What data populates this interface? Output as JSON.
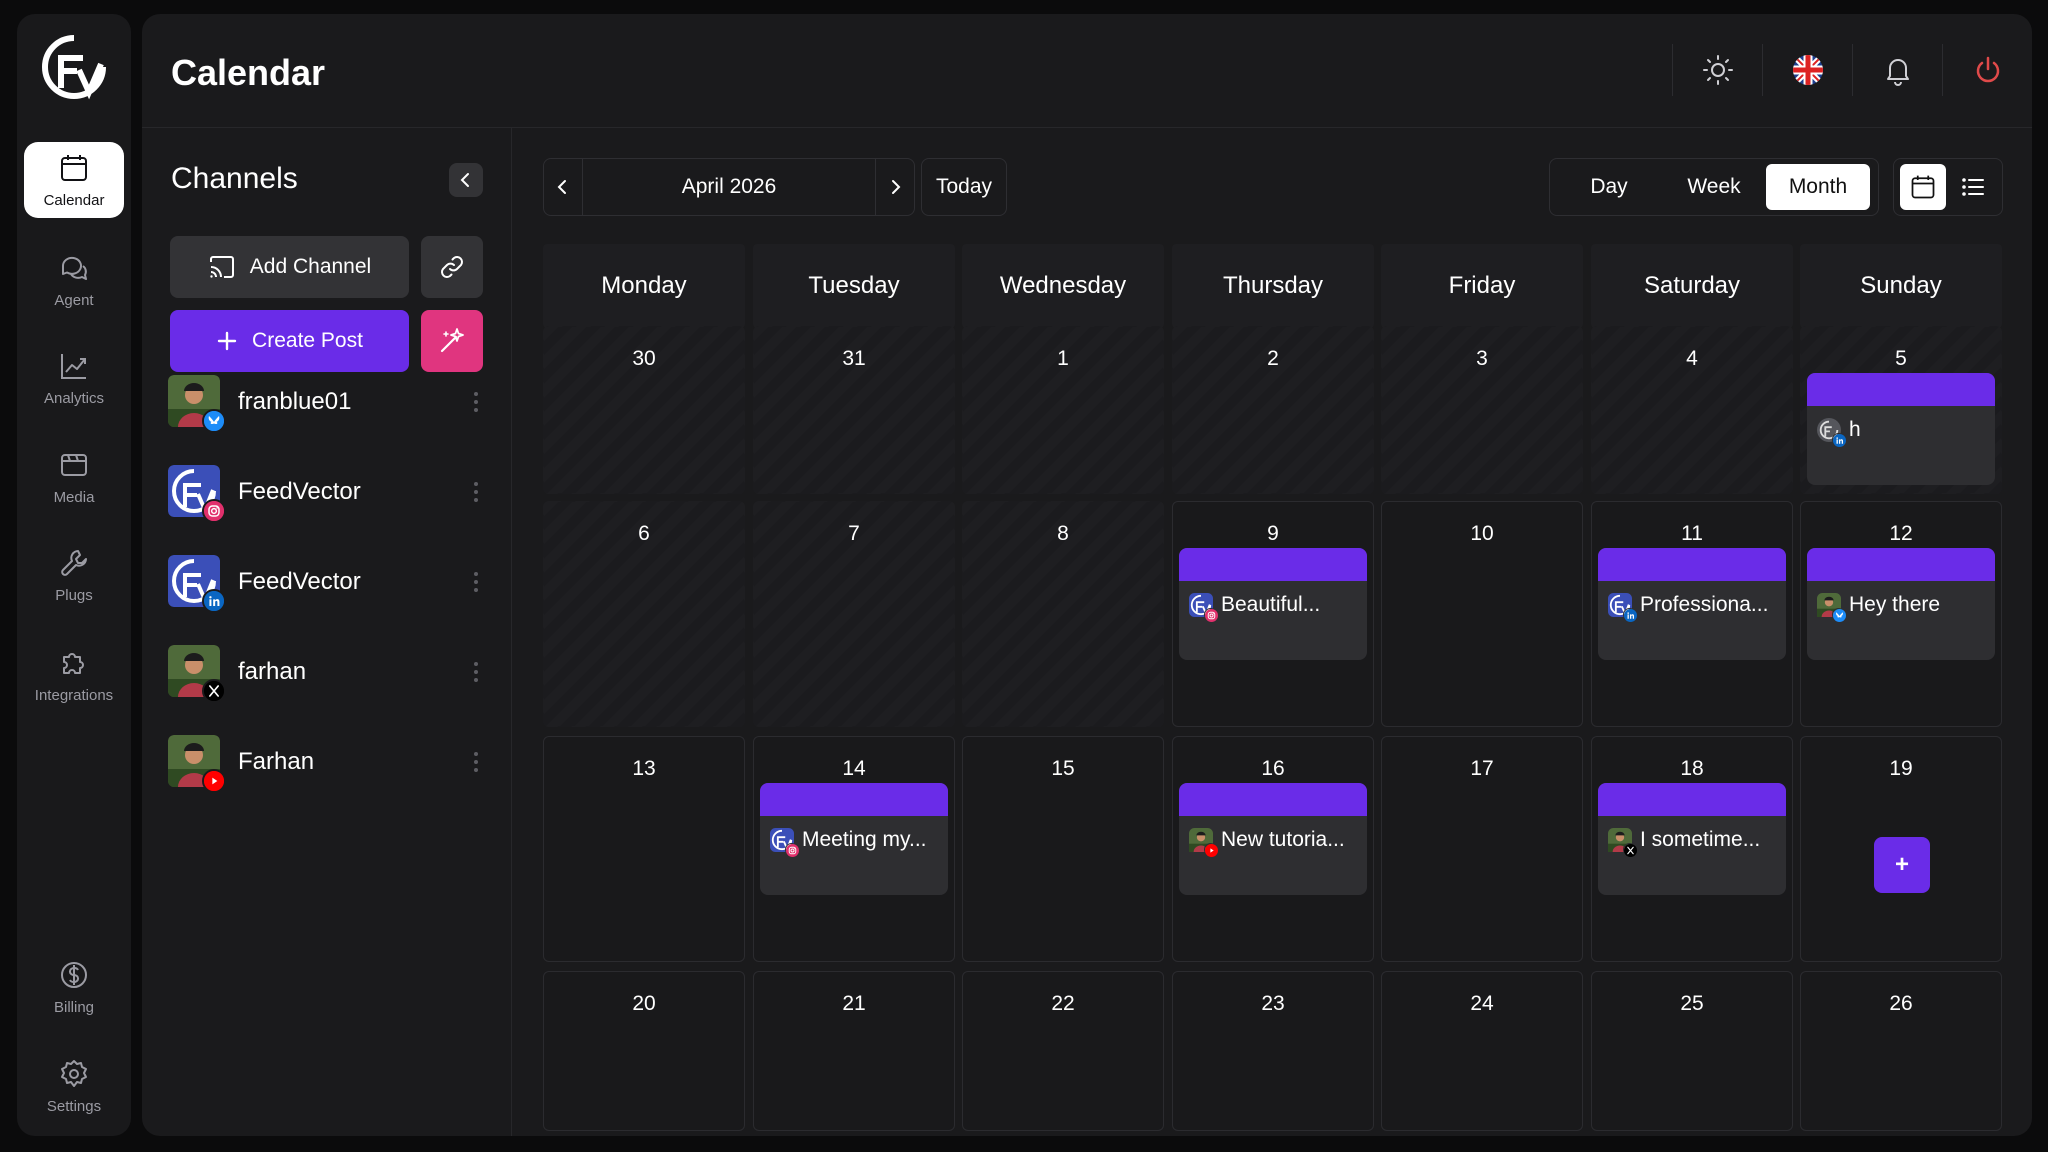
{
  "rail": {
    "items": [
      {
        "label": "Calendar",
        "icon": "calendar-icon",
        "active": true
      },
      {
        "label": "Agent",
        "icon": "chat-icon"
      },
      {
        "label": "Analytics",
        "icon": "chart-icon"
      },
      {
        "label": "Media",
        "icon": "media-icon"
      },
      {
        "label": "Plugs",
        "icon": "wrench-icon"
      },
      {
        "label": "Integrations",
        "icon": "puzzle-icon"
      },
      {
        "label": "Billing",
        "icon": "dollar-icon"
      },
      {
        "label": "Settings",
        "icon": "gear-icon"
      }
    ]
  },
  "header": {
    "title": "Calendar"
  },
  "channels_panel": {
    "title": "Channels",
    "add_channel_label": "Add Channel",
    "create_post_label": "Create Post",
    "channels": [
      {
        "name": "franblue01",
        "network": "bluesky",
        "avatar": "person"
      },
      {
        "name": "FeedVector",
        "network": "instagram",
        "avatar": "logo"
      },
      {
        "name": "FeedVector",
        "network": "linkedin",
        "avatar": "logo"
      },
      {
        "name": "farhan",
        "network": "x",
        "avatar": "person"
      },
      {
        "name": "Farhan",
        "network": "youtube",
        "avatar": "person"
      }
    ]
  },
  "calendar": {
    "month_label": "April 2026",
    "today_label": "Today",
    "views": [
      "Day",
      "Week",
      "Month"
    ],
    "active_view": "Month",
    "weekdays": [
      "Monday",
      "Tuesday",
      "Wednesday",
      "Thursday",
      "Friday",
      "Saturday",
      "Sunday"
    ],
    "weeks": [
      [
        {
          "day": "30",
          "past": true
        },
        {
          "day": "31",
          "past": true
        },
        {
          "day": "1",
          "past": true
        },
        {
          "day": "2",
          "past": true
        },
        {
          "day": "3",
          "past": true
        },
        {
          "day": "4",
          "past": true
        },
        {
          "day": "5",
          "past": true,
          "post": {
            "text": "h",
            "icon": "gray",
            "network": "linkedin"
          }
        }
      ],
      [
        {
          "day": "6",
          "past": true
        },
        {
          "day": "7",
          "past": true
        },
        {
          "day": "8",
          "past": true
        },
        {
          "day": "9",
          "post": {
            "text": "Beautiful...",
            "icon": "logo",
            "network": "instagram"
          }
        },
        {
          "day": "10"
        },
        {
          "day": "11",
          "post": {
            "text": "Professiona...",
            "icon": "logo",
            "network": "linkedin"
          }
        },
        {
          "day": "12",
          "post": {
            "text": "Hey there",
            "icon": "person",
            "network": "bluesky"
          }
        }
      ],
      [
        {
          "day": "13"
        },
        {
          "day": "14",
          "post": {
            "text": "Meeting my...",
            "icon": "logo",
            "network": "instagram"
          }
        },
        {
          "day": "15"
        },
        {
          "day": "16",
          "post": {
            "text": "New tutoria...",
            "icon": "person",
            "network": "youtube"
          }
        },
        {
          "day": "17"
        },
        {
          "day": "18",
          "post": {
            "text": "I sometime...",
            "icon": "person",
            "network": "x"
          }
        },
        {
          "day": "19",
          "add_button": "+"
        }
      ],
      [
        {
          "day": "20"
        },
        {
          "day": "21"
        },
        {
          "day": "22"
        },
        {
          "day": "23"
        },
        {
          "day": "24"
        },
        {
          "day": "25"
        },
        {
          "day": "26"
        }
      ]
    ]
  },
  "colors": {
    "accent": "#6a2ce8",
    "ai_button": "#e0357f",
    "power": "#e04a4a",
    "bluesky": "#1d8cf8",
    "instagram": "#e1306c",
    "linkedin": "#0a66c2",
    "x": "#000000",
    "youtube": "#ff0000"
  },
  "header_icons": [
    "sun-icon",
    "uk-flag-icon",
    "bell-icon",
    "power-icon"
  ]
}
